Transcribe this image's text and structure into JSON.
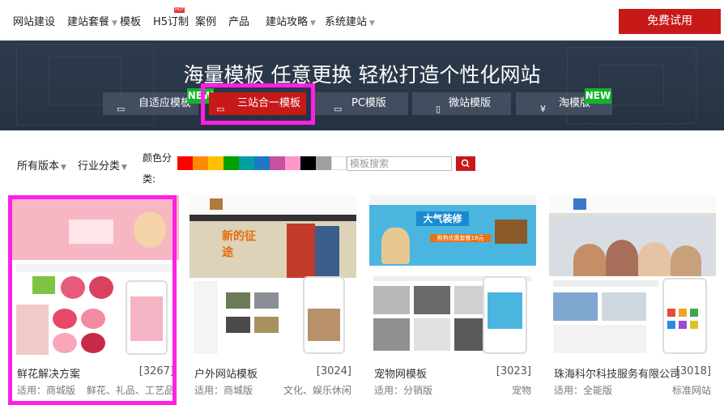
{
  "nav": {
    "items": [
      {
        "label": "网站建设",
        "caret": false
      },
      {
        "label": "建站套餐",
        "caret": true
      },
      {
        "label": "模板",
        "caret": false
      },
      {
        "label": "H5订制",
        "caret": false
      },
      {
        "label": "案例",
        "caret": false
      },
      {
        "label": "产品",
        "caret": false
      },
      {
        "label": "建站攻略",
        "caret": true
      },
      {
        "label": "系统建站",
        "caret": true
      }
    ],
    "hot_badge": "HOT",
    "cta": "免费试用"
  },
  "banner": {
    "title": "海量模板 任意更换 轻松打造个性化网站",
    "tabs": [
      {
        "label": "自适应模板",
        "icon": "monitor-icon",
        "active": false
      },
      {
        "label": "三站合一模板",
        "icon": "monitor-icon",
        "active": true
      },
      {
        "label": "PC模版",
        "icon": "monitor-icon",
        "active": false
      },
      {
        "label": "微站模版",
        "icon": "mobile-icon",
        "active": false
      },
      {
        "label": "淘模版",
        "icon": "yen-icon",
        "active": false
      }
    ],
    "new_badge": "NEW"
  },
  "filters": {
    "version": "所有版本",
    "industry": "行业分类",
    "color_label": "颜色分类:",
    "colors": [
      "#ff0000",
      "#ff8c00",
      "#ffc000",
      "#00a000",
      "#00a0a0",
      "#1e78c8",
      "#c850a0",
      "#ff96c8",
      "#000000",
      "#a0a0a0",
      "#ffffff",
      "multi"
    ],
    "search_placeholder": "模板搜索"
  },
  "cards": [
    {
      "title": "鲜花解决方案",
      "count": "[3267]",
      "meta": "适用：商城版",
      "tag": "鲜花、礼品、工艺品"
    },
    {
      "title": "户外网站模板",
      "count": "[3024]",
      "meta": "适用：商城版",
      "tag": "文化、娱乐休闲"
    },
    {
      "title": "宠物网模板",
      "count": "[3023]",
      "meta": "适用：分销版",
      "tag": "宠物"
    },
    {
      "title": "珠海科尔科技服务有限公司",
      "count": "[3018]",
      "meta": "适用：全能版",
      "tag": "标准网站"
    }
  ],
  "thumbs": {
    "dog_banner": "大气装修",
    "dog_sub": "购狗优惠套餐18元",
    "outdoor_banner": "新的征途"
  },
  "colors": {
    "brand": "#c81919",
    "highlight": "#ff1fe6",
    "new": "#13b52a"
  }
}
